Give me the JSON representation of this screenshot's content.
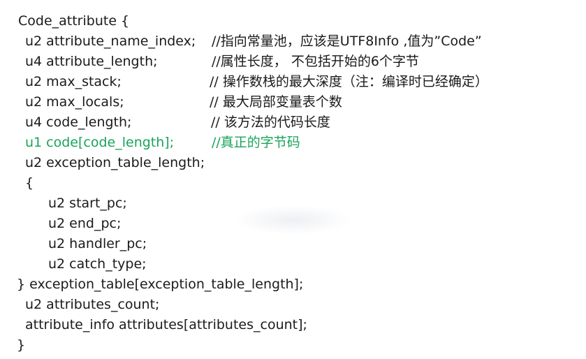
{
  "lines": [
    {
      "code": "Code_attribute {",
      "comment": ""
    },
    {
      "code": "u2 attribute_name_index;",
      "comment": "//指向常量池，应该是UTF8Info ,值为”Code”"
    },
    {
      "code": "u4 attribute_length;",
      "comment": "//属性长度， 不包括开始的6个字节"
    },
    {
      "code": "u2 max_stack;",
      "comment": "// 操作数栈的最大深度（注：编译时已经确定）"
    },
    {
      "code": "u2 max_locals;",
      "comment": "// 最大局部变量表个数"
    },
    {
      "code": "u4 code_length;",
      "comment": "// 该方法的代码长度"
    },
    {
      "code": "u1 code[code_length];",
      "comment": "//真正的字节码"
    },
    {
      "code": "u2 exception_table_length;",
      "comment": ""
    },
    {
      "code": "{",
      "comment": ""
    },
    {
      "code": "u2 start_pc;",
      "comment": ""
    },
    {
      "code": "u2 end_pc;",
      "comment": ""
    },
    {
      "code": "u2 handler_pc;",
      "comment": ""
    },
    {
      "code": "u2 catch_type;",
      "comment": ""
    },
    {
      "code": "} exception_table[exception_table_length];",
      "comment": ""
    },
    {
      "code": "u2 attributes_count;",
      "comment": ""
    },
    {
      "code": "attribute_info attributes[attributes_count];",
      "comment": ""
    },
    {
      "code": "}",
      "comment": ""
    }
  ],
  "colors": {
    "text": "#1a1a1a",
    "highlight": "#1aa35a"
  }
}
